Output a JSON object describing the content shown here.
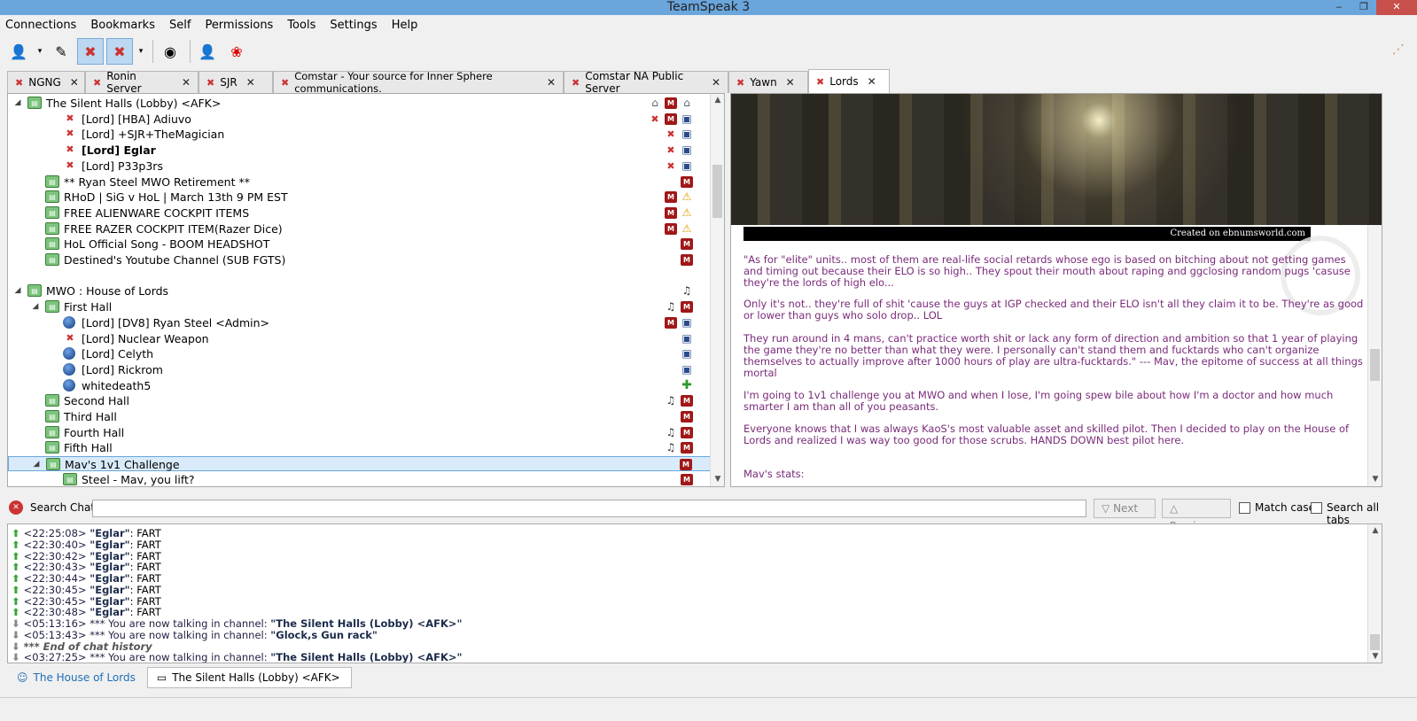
{
  "window": {
    "title": "TeamSpeak 3",
    "controls": [
      "‒",
      "❐",
      "✕"
    ]
  },
  "menu": [
    "Connections",
    "Bookmarks",
    "Self",
    "Permissions",
    "Tools",
    "Settings",
    "Help"
  ],
  "tabs": [
    {
      "label": "NGNG"
    },
    {
      "label": "Ronin Server"
    },
    {
      "label": "SJR"
    },
    {
      "label": "Comstar - Your source for Inner Sphere communications."
    },
    {
      "label": "Comstar NA Public Server"
    },
    {
      "label": "Yawn"
    },
    {
      "label": "Lords"
    }
  ],
  "tree": [
    {
      "label": "The Silent Halls (Lobby) <AFK>",
      "level": 0,
      "arrow": "◢",
      "icon": "chan",
      "badges": [
        "home",
        "m",
        "home"
      ]
    },
    {
      "label": "[Lord] [HBA] Adiuvo",
      "level": 2,
      "icon": "user",
      "badges": [
        "mic",
        "m",
        "shield"
      ]
    },
    {
      "label": "[Lord] +SJR+TheMagician",
      "level": 2,
      "icon": "user",
      "badges": [
        "mic",
        "shield"
      ]
    },
    {
      "label": "[Lord] Eglar",
      "level": 2,
      "icon": "user",
      "bold": true,
      "badges": [
        "mic",
        "shield"
      ]
    },
    {
      "label": "[Lord] P33p3rs",
      "level": 2,
      "icon": "user",
      "badges": [
        "mic",
        "shield"
      ]
    },
    {
      "label": "** Ryan Steel MWO Retirement **",
      "level": 1,
      "icon": "chan",
      "badges": [
        "m"
      ]
    },
    {
      "label": "RHoD | SiG v HoL | March 13th 9 PM EST",
      "level": 1,
      "icon": "chan",
      "badges": [
        "m",
        "warn"
      ]
    },
    {
      "label": "FREE ALIENWARE COCKPIT ITEMS",
      "level": 1,
      "icon": "chan",
      "badges": [
        "m",
        "warn"
      ]
    },
    {
      "label": "FREE RAZER COCKPIT ITEM(Razer Dice)",
      "level": 1,
      "icon": "chan",
      "badges": [
        "m",
        "warn"
      ]
    },
    {
      "label": "HoL Official Song - BOOM HEADSHOT",
      "level": 1,
      "icon": "chan",
      "badges": [
        "m"
      ]
    },
    {
      "label": "Destined's Youtube Channel (SUB FGTS)",
      "level": 1,
      "icon": "chan",
      "badges": [
        "m"
      ]
    },
    {
      "label": "",
      "level": 0,
      "spacer": true,
      "badges": []
    },
    {
      "label": "MWO : House of Lords",
      "level": 0,
      "arrow": "◢",
      "icon": "chan",
      "badges": [
        "note"
      ]
    },
    {
      "label": "First Hall",
      "level": 1,
      "arrow": "◢",
      "icon": "chan",
      "badges": [
        "note",
        "m"
      ]
    },
    {
      "label": "[Lord] [DV8] Ryan Steel <Admin>",
      "level": 2,
      "icon": "ball",
      "badges": [
        "m",
        "shield"
      ]
    },
    {
      "label": "[Lord] Nuclear Weapon",
      "level": 2,
      "icon": "user",
      "badges": [
        "shield"
      ]
    },
    {
      "label": "[Lord] Celyth",
      "level": 2,
      "icon": "ball",
      "badges": [
        "shield"
      ]
    },
    {
      "label": "[Lord] Rickrom",
      "level": 2,
      "icon": "ball",
      "badges": [
        "shield"
      ]
    },
    {
      "label": "whitedeath5",
      "level": 2,
      "icon": "ball",
      "badges": [
        "plus"
      ]
    },
    {
      "label": "Second Hall",
      "level": 1,
      "icon": "chan",
      "badges": [
        "note",
        "m"
      ]
    },
    {
      "label": "Third Hall",
      "level": 1,
      "icon": "chan",
      "badges": [
        "m"
      ]
    },
    {
      "label": "Fourth Hall",
      "level": 1,
      "icon": "chan",
      "badges": [
        "note",
        "m"
      ]
    },
    {
      "label": "Fifth Hall",
      "level": 1,
      "icon": "chan",
      "badges": [
        "note",
        "m"
      ]
    },
    {
      "label": "Mav's 1v1 Challenge",
      "level": 1,
      "arrow": "◢",
      "icon": "chan",
      "selected": true,
      "badges": [
        "m"
      ]
    },
    {
      "label": "Steel - Mav, you lift?",
      "level": 2,
      "icon": "chan",
      "badges": [
        "m"
      ]
    }
  ],
  "info": {
    "banner_caption": "Created on ebnumsworld.com",
    "paragraphs": [
      "\"As for \"elite\" units.. most of them are real-life social retards whose ego is based on bitching about not getting games and timing out because their ELO is so high.. They spout their mouth about raping and ggclosing random pugs 'casuse they're the lords of high elo...",
      "Only it's not.. they're full of shit 'cause the guys at IGP checked and their ELO isn't all they claim it to be. They're as good or lower than guys who solo drop.. LOL",
      "They run around in 4 mans, can't practice worth shit or lack any form of direction and ambition so that 1 year of playing the game they're no better than what they were. I personally can't stand them and fucktards who can't organize themselves to actually improve after 1000 hours of play are ultra-fucktards.\"  --- Mav, the epitome of success at all things mortal",
      "I'm going to 1v1 challenge you at MWO and when I lose, I'm going spew bile about how I'm a doctor and how much smarter I am than all of you peasants.",
      "Everyone knows that I was always KaoS's most valuable asset and skilled pilot.  Then I decided to play on the House of Lords and realized I was way too good for those scrubs.  HANDS DOWN best pilot here.",
      "Mav's stats:"
    ]
  },
  "search": {
    "label": "Search Chat:",
    "value": "",
    "next": "Next",
    "previous": "Previous",
    "match_case": "Match case",
    "search_all": "Search all tabs"
  },
  "chat": [
    {
      "type": "msg",
      "time": "<22:25:08>",
      "nick": "\"Eglar\"",
      "text": ": FART"
    },
    {
      "type": "msg",
      "time": "<22:30:40>",
      "nick": "\"Eglar\"",
      "text": ": FART"
    },
    {
      "type": "msg",
      "time": "<22:30:42>",
      "nick": "\"Eglar\"",
      "text": ": FART"
    },
    {
      "type": "msg",
      "time": "<22:30:43>",
      "nick": "\"Eglar\"",
      "text": ": FART"
    },
    {
      "type": "msg",
      "time": "<22:30:44>",
      "nick": "\"Eglar\"",
      "text": ": FART"
    },
    {
      "type": "msg",
      "time": "<22:30:45>",
      "nick": "\"Eglar\"",
      "text": ": FART"
    },
    {
      "type": "msg",
      "time": "<22:30:45>",
      "nick": "\"Eglar\"",
      "text": ": FART"
    },
    {
      "type": "msg",
      "time": "<22:30:48>",
      "nick": "\"Eglar\"",
      "text": ": FART"
    },
    {
      "type": "sys",
      "time": "<05:13:16>",
      "text": " *** You are now talking in channel: ",
      "channel": "\"The Silent Halls (Lobby) <AFK>\""
    },
    {
      "type": "sys",
      "time": "<05:13:43>",
      "text": " *** You are now talking in channel: ",
      "channel": "\"Glock,s Gun rack\""
    },
    {
      "type": "hist",
      "text": "*** End of chat history"
    },
    {
      "type": "sys",
      "time": "<03:27:25>",
      "text": " *** You are now talking in channel: ",
      "channel": "\"The Silent Halls (Lobby) <AFK>\""
    }
  ],
  "bottom_tabs": [
    {
      "label": "The House of Lords",
      "kind": "server"
    },
    {
      "label": "The Silent Halls (Lobby) <AFK>",
      "kind": "channel"
    }
  ]
}
